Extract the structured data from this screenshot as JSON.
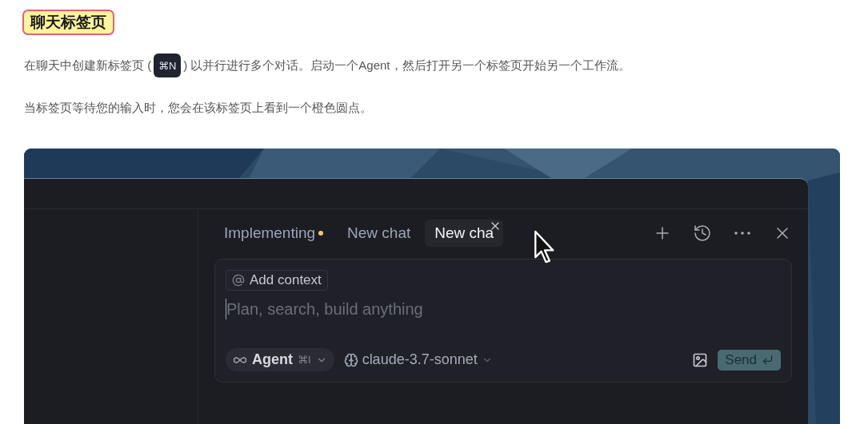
{
  "heading": "聊天标签页",
  "intro": {
    "before": "在聊天中创建新标签页 (",
    "shortcut": "⌘N",
    "after": ") 以并行进行多个对话。启动一个Agent，然后打开另一个标签页开始另一个工作流。"
  },
  "note": "当标签页等待您的输入时，您会在该标签页上看到一个橙色圆点。",
  "screenshot": {
    "tabs": [
      {
        "label": "Implementing",
        "selected": false,
        "waiting": true,
        "close_visible": false
      },
      {
        "label": "New chat",
        "selected": false,
        "waiting": false,
        "close_visible": false
      },
      {
        "label": "New cha",
        "selected": true,
        "waiting": false,
        "close_visible": true
      }
    ],
    "composer": {
      "context_button": "Add context",
      "placeholder": "Plan, search, build anything",
      "mode": {
        "label": "Agent",
        "shortcut": "⌘I"
      },
      "model": "claude-3.7-sonnet",
      "send": {
        "label": "Send",
        "disabled": true
      }
    }
  }
}
